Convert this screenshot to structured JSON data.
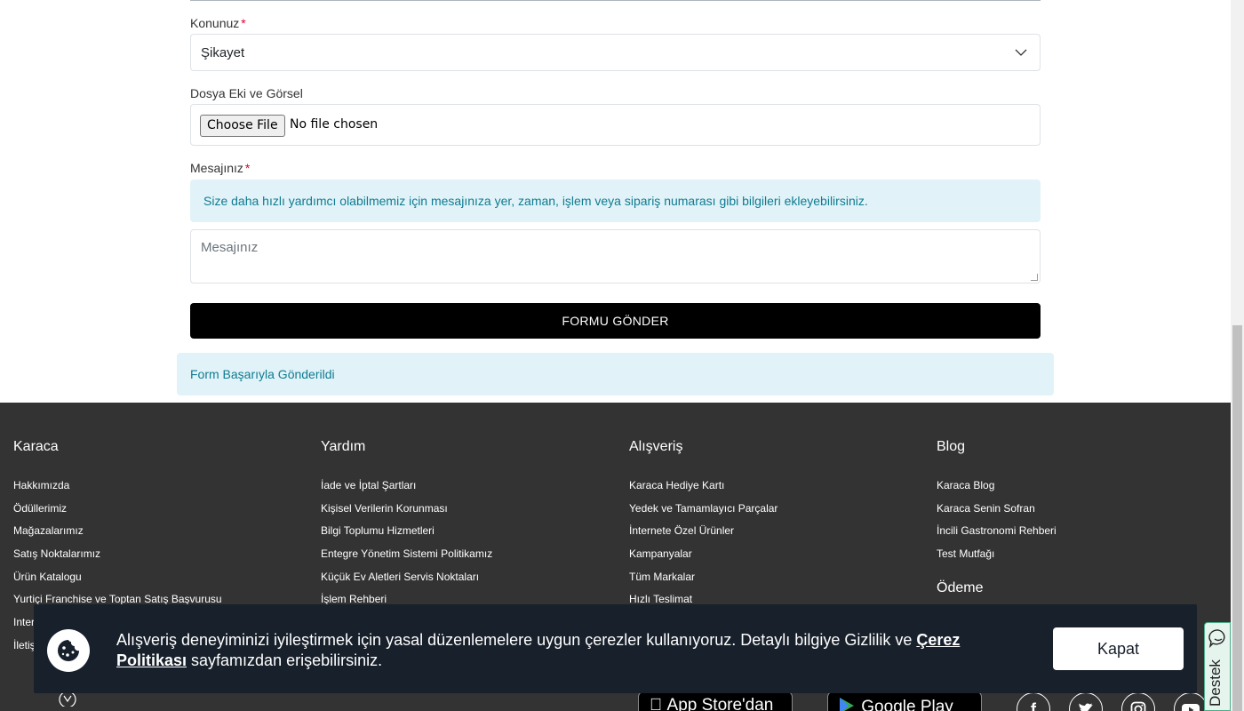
{
  "form": {
    "subject_label": "Konunuz",
    "subject_value": "Şikayet",
    "attachment_label": "Dosya Eki ve Görsel",
    "file_button": "Choose File",
    "file_status": "No file chosen",
    "message_label": "Mesajınız",
    "required_mark": "*",
    "info_text": "Size daha hızlı yardımcı olabilmemiz için mesajınıza yer, zaman, işlem veya sipariş numarası gibi bilgileri ekleyebilirsiniz.",
    "message_placeholder": "Mesajınız",
    "submit_label": "FORMU GÖNDER",
    "success_text": "Form Başarıyla Gönderildi"
  },
  "footer": {
    "columns": [
      {
        "title": "Karaca",
        "items": [
          "Hakkımızda",
          "Ödüllerimiz",
          "Mağazalarımız",
          "Satış Noktalarımız",
          "Ürün Katalogu",
          "Yurtiçi Franchise ve Toptan Satış Başvurusu",
          "Inter",
          "İletiş"
        ]
      },
      {
        "title": "Yardım",
        "items": [
          "İade ve İptal Şartları",
          "Kişisel Verilerin Korunması",
          "Bilgi Toplumu Hizmetleri",
          "Entegre Yönetim Sistemi Politikamız",
          "Küçük Ev Aletleri Servis Noktaları",
          "İşlem Rehberi"
        ]
      },
      {
        "title": "Alışveriş",
        "items": [
          "Karaca Hediye Kartı",
          "Yedek ve Tamamlayıcı Parçalar",
          "İnternete Özel Ürünler",
          "Kampanyalar",
          "Tüm Markalar",
          "Hızlı Teslimat"
        ]
      },
      {
        "title": "Blog",
        "items": [
          "Karaca Blog",
          "Karaca Senin Sofran",
          "İncili Gastronomi Rehberi",
          "Test Mutfağı"
        ]
      }
    ],
    "payment_title": "Ödeme",
    "app_store": "App Store'dan",
    "google_play": "Google Play",
    "social_icons": [
      "facebook-icon",
      "twitter-icon",
      "instagram-icon",
      "youtube-icon"
    ]
  },
  "cookie": {
    "text": "Alışveriş deneyiminizi iyileştirmek için yasal düzenlemelere uygun çerezler kullanıyoruz. Detaylı bilgiye Gizlilik ve ",
    "link": "Çerez Politikası",
    "text_after": " sayfamızdan erişebilirsiniz.",
    "close_label": "Kapat"
  },
  "support": {
    "label": "Destek"
  },
  "colors": {
    "accent_info_bg": "#e1f3f8",
    "accent_info_text": "#0f7b91",
    "footer_bg": "#333333",
    "cookie_bg": "#17202b",
    "required": "#e0002b"
  }
}
